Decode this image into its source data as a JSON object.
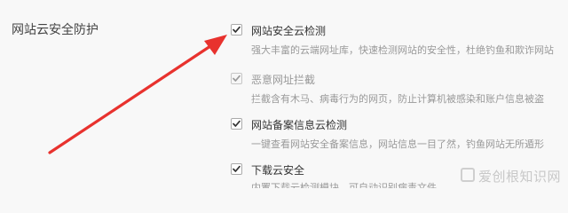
{
  "section": {
    "title": "网站云安全防护"
  },
  "options": [
    {
      "label": "网站安全云检测",
      "description": "强大丰富的云端网址库，快速检测网站的安全性，杜绝钓鱼和欺诈网站",
      "checked": true,
      "disabled": false
    },
    {
      "label": "恶意网址拦截",
      "description": "拦截含有木马、病毒行为的网页，防止计算机被感染和账户信息被盗",
      "checked": true,
      "disabled": true
    },
    {
      "label": "网站备案信息云检测",
      "description": "一键查看网站安全备案信息，网站信息一目了然，钓鱼网站无所遁形",
      "checked": true,
      "disabled": false
    },
    {
      "label": "下载云安全",
      "description": "内置下载云检测模块，可自动识别病毒文件",
      "checked": true,
      "disabled": false
    }
  ],
  "watermark": {
    "text": "爱创根知识网"
  },
  "colors": {
    "arrow": "#e8322e",
    "check": "#333333",
    "check_disabled": "#9a9a9a"
  }
}
